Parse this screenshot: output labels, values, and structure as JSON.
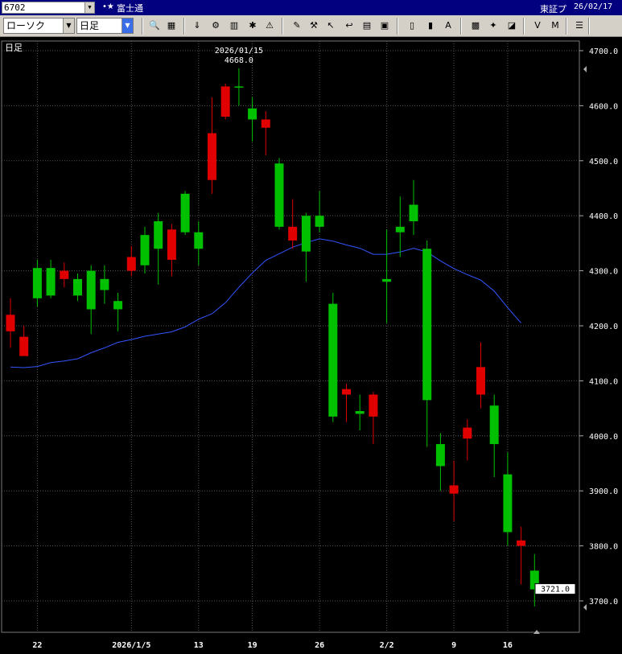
{
  "window": {
    "code": "6702",
    "star": "•★",
    "stock_name": "富士通",
    "market": "東証プ",
    "date": "26/02/17"
  },
  "toolbar": {
    "chart_type": "ローソク",
    "period": "日足",
    "icons": [
      "zoom-icon",
      "grid-icon",
      "download-icon",
      "settings-icon",
      "bars-icon",
      "buy-sell-icon",
      "alert-icon",
      "pen-icon",
      "tool-icon",
      "cursor-icon",
      "arrow-icon",
      "memo-icon",
      "trash-icon",
      "candle-icon",
      "candle-icon-2",
      "all-icon",
      "pattern-icon",
      "magic-icon",
      "color-icon",
      "vwap-icon",
      "ma-icon",
      "menu-icon"
    ]
  },
  "colors": {
    "up": "#00c000",
    "down": "#e00000",
    "ma": "#3355ff",
    "grid": "#555555",
    "background": "#000000"
  },
  "chart_data": {
    "type": "candlestick",
    "period_label": "日足",
    "ylim": [
      3640,
      4740
    ],
    "y_ticks": [
      "4700.0",
      "4600.0",
      "4500.0",
      "4400.0",
      "4300.0",
      "4200.0",
      "4100.0",
      "4000.0",
      "3900.0",
      "3800.0",
      "3700.0"
    ],
    "x_tick_labels": [
      {
        "i": 2,
        "label": "22"
      },
      {
        "i": 9,
        "label": "2026/1/5"
      },
      {
        "i": 14,
        "label": "13"
      },
      {
        "i": 18,
        "label": "19"
      },
      {
        "i": 23,
        "label": "26"
      },
      {
        "i": 28,
        "label": "2/2"
      },
      {
        "i": 33,
        "label": "9"
      },
      {
        "i": 37,
        "label": "16"
      }
    ],
    "candles": [
      {
        "o": 4220,
        "h": 4250,
        "l": 4160,
        "c": 4190
      },
      {
        "o": 4180,
        "h": 4200,
        "l": 4145,
        "c": 4145
      },
      {
        "o": 4250,
        "h": 4320,
        "l": 4235,
        "c": 4305
      },
      {
        "o": 4255,
        "h": 4320,
        "l": 4250,
        "c": 4305
      },
      {
        "o": 4300,
        "h": 4315,
        "l": 4270,
        "c": 4285
      },
      {
        "o": 4255,
        "h": 4295,
        "l": 4245,
        "c": 4285
      },
      {
        "o": 4230,
        "h": 4310,
        "l": 4185,
        "c": 4300
      },
      {
        "o": 4265,
        "h": 4310,
        "l": 4240,
        "c": 4285
      },
      {
        "o": 4230,
        "h": 4260,
        "l": 4190,
        "c": 4245
      },
      {
        "o": 4325,
        "h": 4345,
        "l": 4290,
        "c": 4300
      },
      {
        "o": 4310,
        "h": 4380,
        "l": 4295,
        "c": 4365
      },
      {
        "o": 4340,
        "h": 4405,
        "l": 4275,
        "c": 4390
      },
      {
        "o": 4375,
        "h": 4385,
        "l": 4290,
        "c": 4320
      },
      {
        "o": 4370,
        "h": 4445,
        "l": 4365,
        "c": 4440
      },
      {
        "o": 4340,
        "h": 4390,
        "l": 4310,
        "c": 4370
      },
      {
        "o": 4550,
        "h": 4615,
        "l": 4440,
        "c": 4465
      },
      {
        "o": 4635,
        "h": 4640,
        "l": 4575,
        "c": 4580
      },
      {
        "o": 4635,
        "h": 4668,
        "l": 4600,
        "c": 4635
      },
      {
        "o": 4575,
        "h": 4615,
        "l": 4535,
        "c": 4595
      },
      {
        "o": 4575,
        "h": 4590,
        "l": 4510,
        "c": 4560
      },
      {
        "o": 4380,
        "h": 4505,
        "l": 4375,
        "c": 4495
      },
      {
        "o": 4380,
        "h": 4430,
        "l": 4340,
        "c": 4355
      },
      {
        "o": 4335,
        "h": 4405,
        "l": 4280,
        "c": 4400
      },
      {
        "o": 4380,
        "h": 4445,
        "l": 4370,
        "c": 4400
      },
      {
        "o": 4035,
        "h": 4260,
        "l": 4025,
        "c": 4240
      },
      {
        "o": 4085,
        "h": 4095,
        "l": 4025,
        "c": 4075
      },
      {
        "o": 4040,
        "h": 4075,
        "l": 4010,
        "c": 4045
      },
      {
        "o": 4075,
        "h": 4080,
        "l": 3985,
        "c": 4035
      },
      {
        "o": 4280,
        "h": 4375,
        "l": 4205,
        "c": 4285
      },
      {
        "o": 4370,
        "h": 4435,
        "l": 4325,
        "c": 4380
      },
      {
        "o": 4390,
        "h": 4465,
        "l": 4365,
        "c": 4420
      },
      {
        "o": 4065,
        "h": 4355,
        "l": 3980,
        "c": 4340
      },
      {
        "o": 3945,
        "h": 4005,
        "l": 3900,
        "c": 3985
      },
      {
        "o": 3910,
        "h": 3955,
        "l": 3845,
        "c": 3895
      },
      {
        "o": 4015,
        "h": 4030,
        "l": 3955,
        "c": 3995
      },
      {
        "o": 4125,
        "h": 4170,
        "l": 4050,
        "c": 4075
      },
      {
        "o": 3985,
        "h": 4075,
        "l": 3925,
        "c": 4055
      },
      {
        "o": 3825,
        "h": 3970,
        "l": 3800,
        "c": 3930
      },
      {
        "o": 3810,
        "h": 3835,
        "l": 3730,
        "c": 3800
      },
      {
        "o": 3721,
        "h": 3785,
        "l": 3690,
        "c": 3755
      }
    ],
    "ma_values": [
      4125,
      4124,
      4126,
      4133,
      4136,
      4140,
      4151,
      4160,
      4170,
      4175,
      4181,
      4185,
      4189,
      4198,
      4212,
      4222,
      4242,
      4270,
      4296,
      4319,
      4331,
      4343,
      4351,
      4358,
      4354,
      4347,
      4341,
      4330,
      4330,
      4334,
      4341,
      4334,
      4318,
      4304,
      4293,
      4283,
      4263,
      4233,
      4205
    ],
    "annotations": [
      {
        "text_date": "2026/01/15",
        "text_value": "4668.0",
        "index": 17
      }
    ],
    "last_price_label": "3721.0"
  }
}
